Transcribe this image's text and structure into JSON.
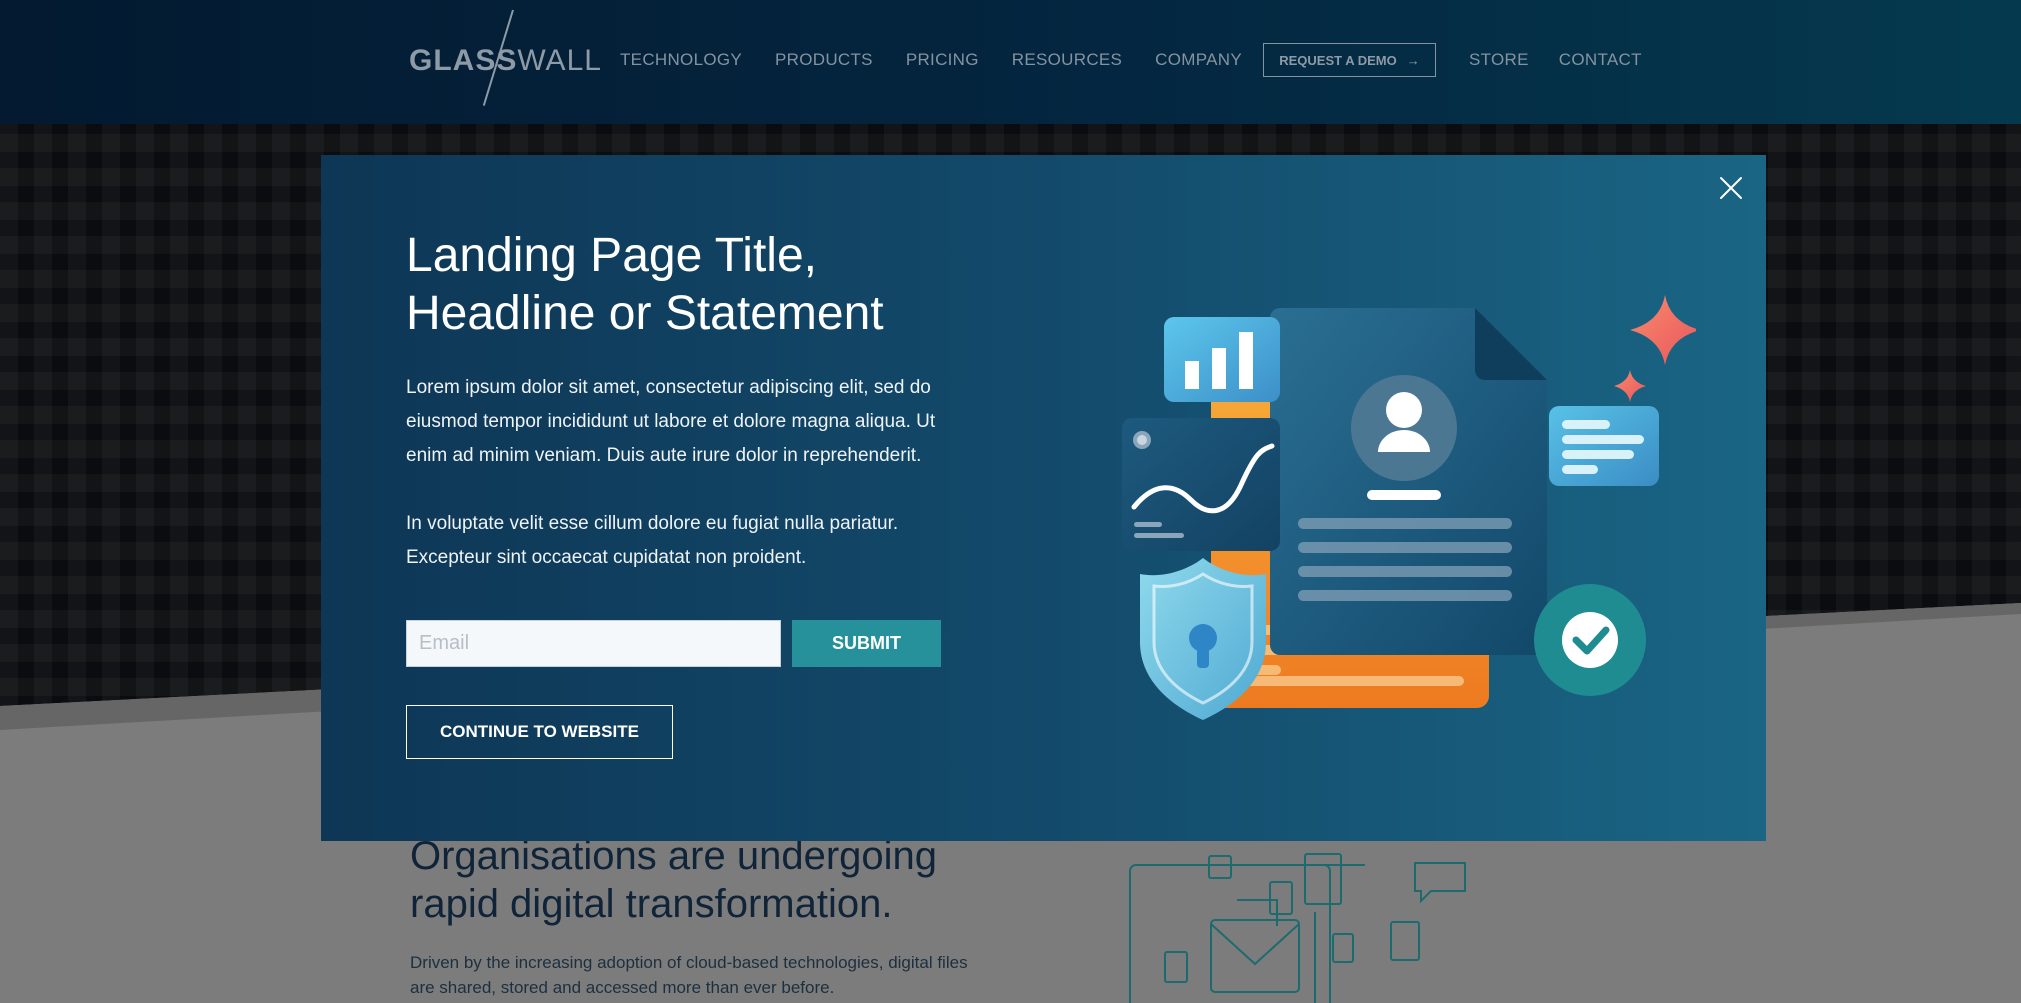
{
  "nav": {
    "logo_bold": "GLASS",
    "logo_thin": "WALL",
    "links": [
      "TECHNOLOGY",
      "PRODUCTS",
      "PRICING",
      "RESOURCES",
      "COMPANY"
    ],
    "demo_label": "REQUEST A DEMO",
    "demo_arrow": "→",
    "right_links": [
      "STORE",
      "CONTACT"
    ]
  },
  "modal": {
    "title_line1": "Landing Page Title,",
    "title_line2": "Headline or Statement",
    "paragraph1": "Lorem ipsum dolor sit amet, consectetur adipiscing elit, sed do eiusmod tempor incididunt ut labore et dolore magna aliqua. Ut enim ad minim veniam. Duis aute irure dolor in reprehenderit.",
    "paragraph2": "In voluptate velit esse cillum dolore eu fugiat nulla pariatur. Excepteur sint occaecat cupidatat non proident.",
    "email_placeholder": "Email",
    "submit_label": "SUBMIT",
    "continue_label": "CONTINUE TO WEBSITE",
    "close_icon": "close-icon"
  },
  "page": {
    "heading": "Organisations are undergoing rapid digital transformation.",
    "body": "Driven by the increasing adoption of cloud-based technologies, digital files are shared, stored and accessed more than ever before."
  },
  "colors": {
    "nav_bg": "#042640",
    "modal_bg": "#134a6b",
    "submit_bg": "#26919a",
    "accent_orange": "#f49a2c",
    "accent_coral": "#ef6b63"
  }
}
